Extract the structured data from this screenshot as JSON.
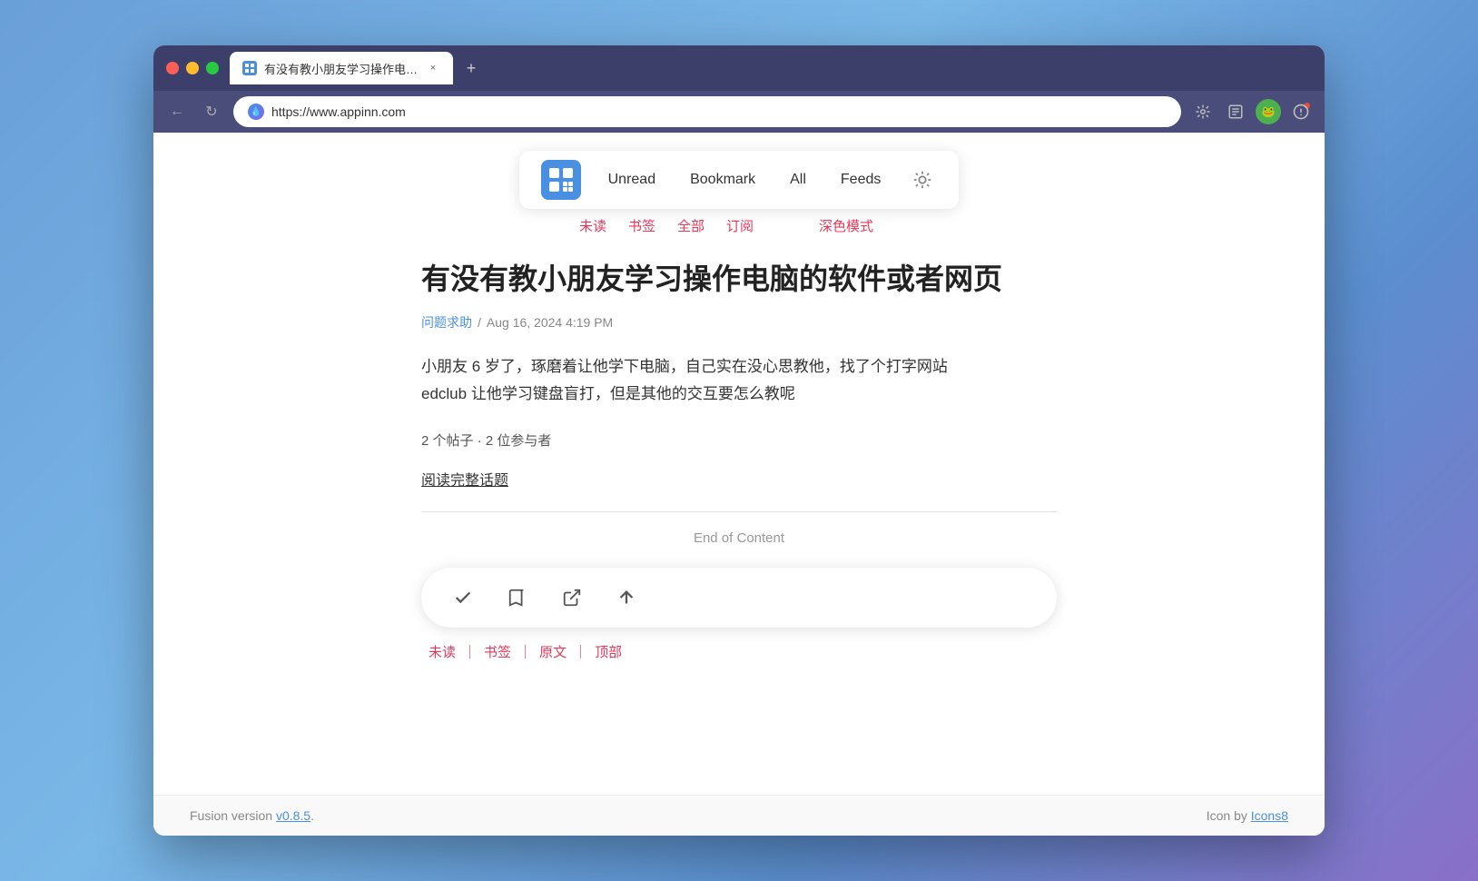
{
  "browser": {
    "tab_title": "有没有教小朋友学习操作电脑的",
    "tab_close": "×",
    "new_tab": "+",
    "url": "https://www.appinn.com",
    "back_icon": "←",
    "refresh_icon": "↻"
  },
  "toolbar": {
    "unread_label": "Unread",
    "bookmark_label": "Bookmark",
    "all_label": "All",
    "feeds_label": "Feeds",
    "unread_cn": "未读",
    "bookmark_cn": "书签",
    "all_cn": "全部",
    "feeds_cn": "订阅",
    "dark_mode_cn": "深色模式"
  },
  "article": {
    "title": "有没有教小朋友学习操作电脑的软件或者网页",
    "category": "问题求助",
    "date": "Aug 16, 2024 4:19 PM",
    "body_line1": "小朋友 6 岁了，琢磨着让他学下电脑，自己实在没心思教他，找了个打字网站",
    "body_line2": "edclub 让他学习键盘盲打，但是其他的交互要怎么教呢",
    "stats": "2 个帖子 · 2 位参与者",
    "read_full": "阅读完整话题",
    "end_of_content": "End of Content"
  },
  "bottom_actions": {
    "mark_unread": "✓",
    "bookmark": "⊡",
    "external_link": "⧉",
    "top": "↑",
    "unread_cn": "未读",
    "bookmark_cn": "书签",
    "original_cn": "原文",
    "top_cn": "顶部"
  },
  "footer": {
    "version_text": "Fusion version ",
    "version_link": "v0.8.5",
    "version_end": ".",
    "icon_text": "Icon by ",
    "icon_link": "Icons8"
  }
}
